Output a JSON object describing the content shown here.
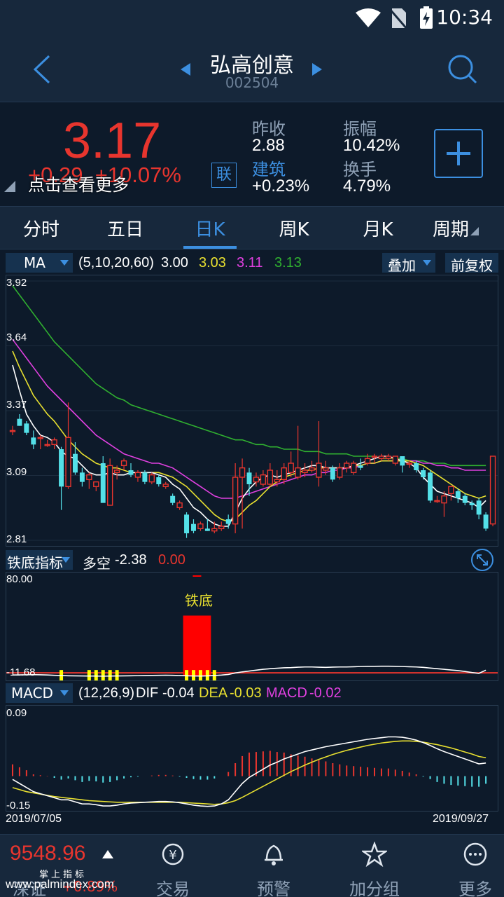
{
  "status": {
    "time": "10:34"
  },
  "header": {
    "name": "弘高创意",
    "code": "002504"
  },
  "quote": {
    "price": "3.17",
    "change": "+0.29",
    "change_pct": "+10.07%",
    "link_badge": "联",
    "tap_more": "点击查看更多",
    "prev_close_label": "昨收",
    "prev_close": "2.88",
    "amplitude_label": "振幅",
    "amplitude": "10.42%",
    "sector_label": "建筑",
    "sector_change": "+0.23%",
    "turnover_label": "换手",
    "turnover": "4.79%"
  },
  "tabs": [
    "分时",
    "五日",
    "日K",
    "周K",
    "月K",
    "周期"
  ],
  "active_tab": "日K",
  "main_indicator": {
    "selector": "MA",
    "params": "(5,10,20,60)",
    "ma5": "3.00",
    "ma10": "3.03",
    "ma20": "3.11",
    "ma60": "3.13",
    "overlay": "叠加",
    "adjust": "前复权",
    "y_labels": [
      "3.92",
      "3.64",
      "3.37",
      "3.09",
      "2.81"
    ]
  },
  "sub1": {
    "selector": "铁底指标",
    "label": "多空",
    "value": "-2.38",
    "value2": "0.00",
    "y_top": "80.00",
    "y_bottom": "-11.68",
    "signal": "铁底"
  },
  "sub2": {
    "selector": "MACD",
    "params": "(12,26,9)",
    "dif_label": "DIF",
    "dif": "-0.04",
    "dea_label": "DEA",
    "dea": "-0.03",
    "macd_label": "MACD",
    "macd": "-0.02",
    "y_top": "0.09",
    "y_bottom": "-0.15",
    "date_start": "2019/07/05",
    "date_end": "2019/09/27"
  },
  "bottom": {
    "index_value": "9548.96",
    "index_name": "深证",
    "index_change": "+0.89%",
    "index_caption": "掌上指标",
    "nav": [
      "交易",
      "预警",
      "加分组",
      "更多"
    ]
  },
  "watermark": "www.palmindex.com",
  "colors": {
    "up": "#e8352e",
    "down": "#54e0e8",
    "ma5": "#ffffff",
    "ma10": "#e8e030",
    "ma20": "#e040e0",
    "ma60": "#30b030",
    "accent": "#3c8fe0"
  },
  "chart_data": {
    "type": "candlestick",
    "title": "",
    "xlabel": "",
    "ylabel": "",
    "x_range": [
      "2019/07/05",
      "2019/09/27"
    ],
    "ylim": [
      2.81,
      3.92
    ],
    "candles": [
      {
        "o": 3.28,
        "h": 3.3,
        "l": 3.26,
        "c": 3.28
      },
      {
        "o": 3.33,
        "h": 3.35,
        "l": 3.3,
        "c": 3.3
      },
      {
        "o": 3.31,
        "h": 3.32,
        "l": 3.26,
        "c": 3.27
      },
      {
        "o": 3.25,
        "h": 3.28,
        "l": 3.2,
        "c": 3.22
      },
      {
        "o": 3.25,
        "h": 3.26,
        "l": 3.2,
        "c": 3.25
      },
      {
        "o": 3.22,
        "h": 3.24,
        "l": 3.21,
        "c": 3.22
      },
      {
        "o": 3.22,
        "h": 3.25,
        "l": 3.2,
        "c": 3.24
      },
      {
        "o": 3.2,
        "h": 3.21,
        "l": 2.94,
        "c": 3.04
      },
      {
        "o": 3.04,
        "h": 3.4,
        "l": 3.03,
        "c": 3.25
      },
      {
        "o": 3.18,
        "h": 3.23,
        "l": 3.09,
        "c": 3.1
      },
      {
        "o": 3.1,
        "h": 3.12,
        "l": 3.04,
        "c": 3.06
      },
      {
        "o": 3.07,
        "h": 3.1,
        "l": 3.03,
        "c": 3.09
      },
      {
        "o": 3.04,
        "h": 3.06,
        "l": 3.02,
        "c": 3.06
      },
      {
        "o": 3.14,
        "h": 3.17,
        "l": 3.01,
        "c": 2.97
      },
      {
        "o": 2.96,
        "h": 3.16,
        "l": 2.96,
        "c": 3.13
      },
      {
        "o": 3.1,
        "h": 3.13,
        "l": 3.07,
        "c": 3.11
      },
      {
        "o": 3.13,
        "h": 3.16,
        "l": 3.11,
        "c": 3.15
      },
      {
        "o": 3.11,
        "h": 3.14,
        "l": 3.08,
        "c": 3.09
      },
      {
        "o": 3.08,
        "h": 3.11,
        "l": 3.06,
        "c": 3.1
      },
      {
        "o": 3.1,
        "h": 3.11,
        "l": 3.05,
        "c": 3.06
      },
      {
        "o": 3.06,
        "h": 3.1,
        "l": 3.05,
        "c": 3.09
      },
      {
        "o": 3.08,
        "h": 3.09,
        "l": 3.04,
        "c": 3.05
      },
      {
        "o": 3.04,
        "h": 3.06,
        "l": 3.03,
        "c": 3.05
      },
      {
        "o": 3.0,
        "h": 3.01,
        "l": 2.96,
        "c": 2.97
      },
      {
        "o": 2.95,
        "h": 2.98,
        "l": 2.94,
        "c": 2.97
      },
      {
        "o": 2.92,
        "h": 2.93,
        "l": 2.82,
        "c": 2.84
      },
      {
        "o": 2.88,
        "h": 2.9,
        "l": 2.84,
        "c": 2.85
      },
      {
        "o": 2.86,
        "h": 2.89,
        "l": 2.85,
        "c": 2.88
      },
      {
        "o": 2.86,
        "h": 2.9,
        "l": 2.85,
        "c": 2.85
      },
      {
        "o": 2.85,
        "h": 2.89,
        "l": 2.84,
        "c": 2.86
      },
      {
        "o": 2.86,
        "h": 2.89,
        "l": 2.85,
        "c": 2.87
      },
      {
        "o": 2.9,
        "h": 2.92,
        "l": 2.86,
        "c": 2.88
      },
      {
        "o": 2.88,
        "h": 3.14,
        "l": 2.84,
        "c": 3.08
      },
      {
        "o": 3.08,
        "h": 3.16,
        "l": 2.86,
        "c": 3.12
      },
      {
        "o": 3.1,
        "h": 3.12,
        "l": 3.0,
        "c": 3.05
      },
      {
        "o": 3.06,
        "h": 3.1,
        "l": 3.04,
        "c": 3.08
      },
      {
        "o": 3.05,
        "h": 3.11,
        "l": 3.04,
        "c": 3.09
      },
      {
        "o": 3.05,
        "h": 3.14,
        "l": 3.04,
        "c": 3.11
      },
      {
        "o": 3.06,
        "h": 3.11,
        "l": 3.04,
        "c": 3.07
      },
      {
        "o": 3.07,
        "h": 3.14,
        "l": 3.05,
        "c": 3.12
      },
      {
        "o": 3.1,
        "h": 3.19,
        "l": 3.08,
        "c": 3.14
      },
      {
        "o": 3.08,
        "h": 3.3,
        "l": 3.07,
        "c": 3.12
      },
      {
        "o": 3.1,
        "h": 3.14,
        "l": 3.08,
        "c": 3.11
      },
      {
        "o": 3.11,
        "h": 3.15,
        "l": 3.1,
        "c": 3.12
      },
      {
        "o": 3.08,
        "h": 3.32,
        "l": 3.04,
        "c": 3.14
      },
      {
        "o": 3.11,
        "h": 3.15,
        "l": 3.09,
        "c": 3.12
      },
      {
        "o": 3.12,
        "h": 3.13,
        "l": 3.06,
        "c": 3.07
      },
      {
        "o": 3.08,
        "h": 3.14,
        "l": 3.07,
        "c": 3.12
      },
      {
        "o": 3.12,
        "h": 3.15,
        "l": 3.1,
        "c": 3.14
      },
      {
        "o": 3.1,
        "h": 3.15,
        "l": 3.09,
        "c": 3.14
      },
      {
        "o": 3.13,
        "h": 3.16,
        "l": 3.11,
        "c": 3.12
      },
      {
        "o": 3.14,
        "h": 3.18,
        "l": 3.13,
        "c": 3.16
      },
      {
        "o": 3.17,
        "h": 3.18,
        "l": 3.14,
        "c": 3.17
      },
      {
        "o": 3.16,
        "h": 3.18,
        "l": 3.15,
        "c": 3.17
      },
      {
        "o": 3.16,
        "h": 3.18,
        "l": 3.15,
        "c": 3.17
      },
      {
        "o": 3.14,
        "h": 3.17,
        "l": 3.13,
        "c": 3.17
      },
      {
        "o": 3.17,
        "h": 3.17,
        "l": 3.1,
        "c": 3.13
      },
      {
        "o": 3.14,
        "h": 3.15,
        "l": 3.12,
        "c": 3.14
      },
      {
        "o": 3.14,
        "h": 3.15,
        "l": 3.1,
        "c": 3.11
      },
      {
        "o": 3.11,
        "h": 3.12,
        "l": 3.07,
        "c": 3.08
      },
      {
        "o": 3.1,
        "h": 3.11,
        "l": 2.97,
        "c": 2.98
      },
      {
        "o": 2.98,
        "h": 3.0,
        "l": 2.97,
        "c": 2.98
      },
      {
        "o": 2.97,
        "h": 3.02,
        "l": 2.91,
        "c": 3.0
      },
      {
        "o": 3.01,
        "h": 3.04,
        "l": 2.98,
        "c": 3.04
      },
      {
        "o": 3.02,
        "h": 3.03,
        "l": 2.97,
        "c": 2.99
      },
      {
        "o": 3.0,
        "h": 3.01,
        "l": 2.96,
        "c": 2.97
      },
      {
        "o": 2.97,
        "h": 2.98,
        "l": 2.94,
        "c": 2.96
      },
      {
        "o": 2.98,
        "h": 2.99,
        "l": 2.9,
        "c": 2.92
      },
      {
        "o": 2.92,
        "h": 2.93,
        "l": 2.85,
        "c": 2.86
      },
      {
        "o": 2.88,
        "h": 3.17,
        "l": 2.87,
        "c": 3.17
      }
    ],
    "ma5": [
      3.56,
      3.45,
      3.35,
      3.3,
      3.26,
      3.25,
      3.23,
      3.19,
      3.17,
      3.16,
      3.13,
      3.1,
      3.09,
      3.09,
      3.1,
      3.09,
      3.09,
      3.1,
      3.1,
      3.1,
      3.1,
      3.09,
      3.08,
      3.05,
      3.03,
      2.99,
      2.95,
      2.93,
      2.9,
      2.88,
      2.87,
      2.87,
      2.93,
      2.99,
      3.03,
      3.06,
      3.08,
      3.09,
      3.08,
      3.09,
      3.1,
      3.11,
      3.12,
      3.13,
      3.13,
      3.12,
      3.12,
      3.12,
      3.12,
      3.13,
      3.14,
      3.15,
      3.16,
      3.17,
      3.17,
      3.16,
      3.15,
      3.14,
      3.12,
      3.08,
      3.05,
      3.02,
      3.01,
      3.0,
      2.99,
      2.98,
      2.97,
      2.95,
      2.98
    ],
    "ma10": [
      3.62,
      3.55,
      3.49,
      3.43,
      3.39,
      3.35,
      3.32,
      3.28,
      3.24,
      3.21,
      3.18,
      3.16,
      3.14,
      3.13,
      3.12,
      3.12,
      3.11,
      3.1,
      3.1,
      3.1,
      3.1,
      3.1,
      3.09,
      3.08,
      3.06,
      3.04,
      3.01,
      2.98,
      2.95,
      2.92,
      2.9,
      2.89,
      2.9,
      2.93,
      2.96,
      2.98,
      3.01,
      3.04,
      3.06,
      3.08,
      3.09,
      3.1,
      3.11,
      3.11,
      3.12,
      3.12,
      3.12,
      3.12,
      3.12,
      3.13,
      3.13,
      3.14,
      3.14,
      3.15,
      3.15,
      3.15,
      3.15,
      3.15,
      3.14,
      3.13,
      3.11,
      3.09,
      3.07,
      3.05,
      3.03,
      3.01,
      3.0,
      2.99,
      3.0
    ],
    "ma20": [
      3.67,
      3.63,
      3.59,
      3.55,
      3.51,
      3.47,
      3.44,
      3.41,
      3.38,
      3.35,
      3.32,
      3.29,
      3.26,
      3.24,
      3.22,
      3.2,
      3.18,
      3.17,
      3.16,
      3.15,
      3.14,
      3.14,
      3.13,
      3.12,
      3.1,
      3.08,
      3.06,
      3.04,
      3.02,
      3.0,
      2.99,
      2.99,
      2.99,
      3.0,
      3.01,
      3.02,
      3.03,
      3.04,
      3.05,
      3.06,
      3.07,
      3.08,
      3.09,
      3.09,
      3.1,
      3.1,
      3.11,
      3.11,
      3.12,
      3.12,
      3.13,
      3.14,
      3.14,
      3.15,
      3.15,
      3.15,
      3.15,
      3.15,
      3.15,
      3.14,
      3.14,
      3.13,
      3.13,
      3.12,
      3.12,
      3.11,
      3.11,
      3.11,
      3.11
    ],
    "ma60": [
      3.9,
      3.86,
      3.82,
      3.78,
      3.74,
      3.7,
      3.66,
      3.63,
      3.6,
      3.57,
      3.54,
      3.51,
      3.48,
      3.46,
      3.44,
      3.42,
      3.41,
      3.39,
      3.38,
      3.37,
      3.36,
      3.35,
      3.34,
      3.33,
      3.32,
      3.31,
      3.3,
      3.29,
      3.28,
      3.27,
      3.26,
      3.25,
      3.24,
      3.24,
      3.23,
      3.22,
      3.22,
      3.21,
      3.21,
      3.2,
      3.2,
      3.2,
      3.19,
      3.19,
      3.19,
      3.18,
      3.18,
      3.18,
      3.18,
      3.17,
      3.17,
      3.17,
      3.17,
      3.16,
      3.16,
      3.16,
      3.16,
      3.15,
      3.15,
      3.15,
      3.14,
      3.14,
      3.14,
      3.13,
      3.13,
      3.13,
      3.13,
      3.13,
      3.13
    ],
    "macd": {
      "ylim": [
        -0.15,
        0.09
      ],
      "dif": [
        -0.08,
        -0.09,
        -0.1,
        -0.11,
        -0.115,
        -0.12,
        -0.125,
        -0.13,
        -0.13,
        -0.135,
        -0.14,
        -0.14,
        -0.142,
        -0.145,
        -0.145,
        -0.143,
        -0.14,
        -0.138,
        -0.137,
        -0.136,
        -0.135,
        -0.134,
        -0.134,
        -0.135,
        -0.137,
        -0.14,
        -0.143,
        -0.145,
        -0.146,
        -0.145,
        -0.14,
        -0.13,
        -0.11,
        -0.09,
        -0.075,
        -0.065,
        -0.055,
        -0.045,
        -0.038,
        -0.03,
        -0.024,
        -0.018,
        -0.012,
        -0.008,
        -0.004,
        0.0,
        0.003,
        0.006,
        0.009,
        0.012,
        0.015,
        0.018,
        0.02,
        0.022,
        0.024,
        0.024,
        0.023,
        0.02,
        0.016,
        0.01,
        0.003,
        -0.005,
        -0.012,
        -0.018,
        -0.024,
        -0.03,
        -0.036,
        -0.042,
        -0.04
      ],
      "dea": [
        -0.1,
        -0.105,
        -0.11,
        -0.113,
        -0.116,
        -0.119,
        -0.122,
        -0.124,
        -0.126,
        -0.128,
        -0.13,
        -0.132,
        -0.133,
        -0.134,
        -0.135,
        -0.136,
        -0.136,
        -0.136,
        -0.136,
        -0.136,
        -0.136,
        -0.136,
        -0.136,
        -0.136,
        -0.136,
        -0.137,
        -0.138,
        -0.139,
        -0.14,
        -0.141,
        -0.14,
        -0.137,
        -0.132,
        -0.124,
        -0.115,
        -0.106,
        -0.097,
        -0.088,
        -0.079,
        -0.07,
        -0.061,
        -0.053,
        -0.045,
        -0.038,
        -0.031,
        -0.025,
        -0.019,
        -0.014,
        -0.009,
        -0.005,
        -0.001,
        0.003,
        0.006,
        0.009,
        0.011,
        0.013,
        0.014,
        0.014,
        0.013,
        0.011,
        0.008,
        0.005,
        0.001,
        -0.003,
        -0.008,
        -0.013,
        -0.018,
        -0.024,
        -0.027
      ],
      "hist": [
        0.04,
        0.03,
        0.02,
        0.006,
        0.003,
        0.001,
        -0.006,
        -0.012,
        -0.008,
        -0.014,
        -0.02,
        -0.016,
        -0.018,
        -0.022,
        -0.02,
        -0.014,
        -0.008,
        -0.004,
        -0.002,
        0.0,
        0.002,
        0.004,
        0.004,
        0.002,
        -0.002,
        -0.006,
        -0.01,
        -0.012,
        -0.012,
        -0.008,
        0.0,
        0.014,
        0.044,
        0.068,
        0.08,
        0.082,
        0.084,
        0.086,
        0.082,
        0.08,
        0.074,
        0.07,
        0.066,
        0.06,
        0.054,
        0.05,
        0.044,
        0.04,
        0.036,
        0.034,
        0.032,
        0.03,
        0.028,
        0.026,
        0.026,
        0.022,
        0.018,
        0.012,
        0.006,
        -0.002,
        -0.01,
        -0.02,
        -0.026,
        -0.03,
        -0.032,
        -0.034,
        -0.036,
        -0.036,
        -0.026
      ]
    },
    "tiedi": {
      "ylim": [
        -11.68,
        80.0
      ],
      "line": [
        -10.5,
        -10.4,
        -10.3,
        -10.2,
        -10.3,
        -10.5,
        -10.8,
        -11.0,
        -11.2,
        -11.3,
        -11.4,
        -11.5,
        -11.5,
        -11.6,
        -11.5,
        -11.4,
        -11.3,
        -11.2,
        -11.1,
        -11.0,
        -10.9,
        -10.8,
        -10.7,
        -10.8,
        -11.0,
        -11.2,
        -11.4,
        -11.5,
        -11.3,
        -11.0,
        -10.6,
        -10.0,
        -8.6,
        -7.6,
        -6.8,
        -6.0,
        -5.2,
        -4.6,
        -4.2,
        -3.8,
        -3.6,
        -3.2,
        -3.0,
        -3.0,
        -3.2,
        -3.4,
        -3.1,
        -3.0,
        -3.0,
        -2.8,
        -2.6,
        -2.4,
        -2.4,
        -2.3,
        -2.3,
        -2.4,
        -2.6,
        -2.8,
        -3.0,
        -3.4,
        -4.0,
        -4.6,
        -5.2,
        -5.8,
        -6.4,
        -7.2,
        -8.2,
        -9.0,
        -6.0
      ],
      "red_bar_indices": [
        25,
        26,
        27,
        28
      ],
      "yellow_bar_indices": [
        7,
        11,
        12,
        13,
        14,
        15,
        25,
        26,
        27,
        28,
        29
      ]
    }
  }
}
